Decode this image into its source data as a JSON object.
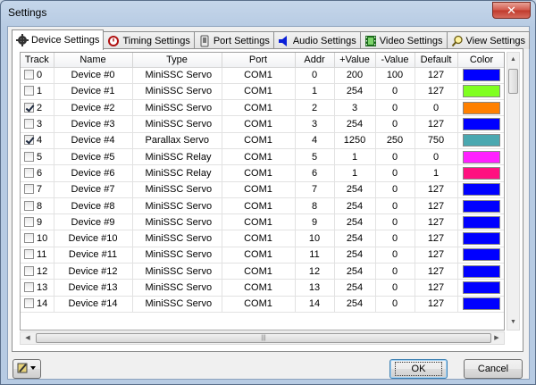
{
  "window": {
    "title": "Settings",
    "close_glyph": "✕"
  },
  "tabs": [
    {
      "label": "Device Settings",
      "icon": "gear-icon",
      "active": true
    },
    {
      "label": "Timing Settings",
      "icon": "timer-icon",
      "active": false
    },
    {
      "label": "Port Settings",
      "icon": "port-icon",
      "active": false
    },
    {
      "label": "Audio Settings",
      "icon": "speaker-icon",
      "active": false
    },
    {
      "label": "Video Settings",
      "icon": "film-icon",
      "active": false
    },
    {
      "label": "View Settings",
      "icon": "magnifier-icon",
      "active": false
    }
  ],
  "table": {
    "columns": [
      "Track",
      "Name",
      "Type",
      "Port",
      "Addr",
      "+Value",
      "-Value",
      "Default",
      "Color"
    ],
    "rows": [
      {
        "track": "0",
        "checked": false,
        "name": "Device #0",
        "type": "MiniSSC Servo",
        "port": "COM1",
        "addr": "0",
        "plus": "200",
        "minus": "100",
        "default": "127",
        "color": "#0000ff"
      },
      {
        "track": "1",
        "checked": false,
        "name": "Device #1",
        "type": "MiniSSC Servo",
        "port": "COM1",
        "addr": "1",
        "plus": "254",
        "minus": "0",
        "default": "127",
        "color": "#80ff20"
      },
      {
        "track": "2",
        "checked": true,
        "name": "Device #2",
        "type": "MiniSSC Servo",
        "port": "COM1",
        "addr": "2",
        "plus": "3",
        "minus": "0",
        "default": "0",
        "color": "#ff8000"
      },
      {
        "track": "3",
        "checked": false,
        "name": "Device #3",
        "type": "MiniSSC Servo",
        "port": "COM1",
        "addr": "3",
        "plus": "254",
        "minus": "0",
        "default": "127",
        "color": "#0000ff"
      },
      {
        "track": "4",
        "checked": true,
        "name": "Device #4",
        "type": "Parallax Servo",
        "port": "COM1",
        "addr": "4",
        "plus": "1250",
        "minus": "250",
        "default": "750",
        "color": "#4aa8b0"
      },
      {
        "track": "5",
        "checked": false,
        "name": "Device #5",
        "type": "MiniSSC Relay",
        "port": "COM1",
        "addr": "5",
        "plus": "1",
        "minus": "0",
        "default": "0",
        "color": "#ff20ff"
      },
      {
        "track": "6",
        "checked": false,
        "name": "Device #6",
        "type": "MiniSSC Relay",
        "port": "COM1",
        "addr": "6",
        "plus": "1",
        "minus": "0",
        "default": "1",
        "color": "#ff1080"
      },
      {
        "track": "7",
        "checked": false,
        "name": "Device #7",
        "type": "MiniSSC Servo",
        "port": "COM1",
        "addr": "7",
        "plus": "254",
        "minus": "0",
        "default": "127",
        "color": "#0000ff"
      },
      {
        "track": "8",
        "checked": false,
        "name": "Device #8",
        "type": "MiniSSC Servo",
        "port": "COM1",
        "addr": "8",
        "plus": "254",
        "minus": "0",
        "default": "127",
        "color": "#0000ff"
      },
      {
        "track": "9",
        "checked": false,
        "name": "Device #9",
        "type": "MiniSSC Servo",
        "port": "COM1",
        "addr": "9",
        "plus": "254",
        "minus": "0",
        "default": "127",
        "color": "#0000ff"
      },
      {
        "track": "10",
        "checked": false,
        "name": "Device #10",
        "type": "MiniSSC Servo",
        "port": "COM1",
        "addr": "10",
        "plus": "254",
        "minus": "0",
        "default": "127",
        "color": "#0000ff"
      },
      {
        "track": "11",
        "checked": false,
        "name": "Device #11",
        "type": "MiniSSC Servo",
        "port": "COM1",
        "addr": "11",
        "plus": "254",
        "minus": "0",
        "default": "127",
        "color": "#0000ff"
      },
      {
        "track": "12",
        "checked": false,
        "name": "Device #12",
        "type": "MiniSSC Servo",
        "port": "COM1",
        "addr": "12",
        "plus": "254",
        "minus": "0",
        "default": "127",
        "color": "#0000ff"
      },
      {
        "track": "13",
        "checked": false,
        "name": "Device #13",
        "type": "MiniSSC Servo",
        "port": "COM1",
        "addr": "13",
        "plus": "254",
        "minus": "0",
        "default": "127",
        "color": "#0000ff"
      },
      {
        "track": "14",
        "checked": false,
        "name": "Device #14",
        "type": "MiniSSC Servo",
        "port": "COM1",
        "addr": "14",
        "plus": "254",
        "minus": "0",
        "default": "127",
        "color": "#0000ff"
      }
    ]
  },
  "buttons": {
    "ok": "OK",
    "cancel": "Cancel",
    "tool_icon": "wrench-icon"
  }
}
